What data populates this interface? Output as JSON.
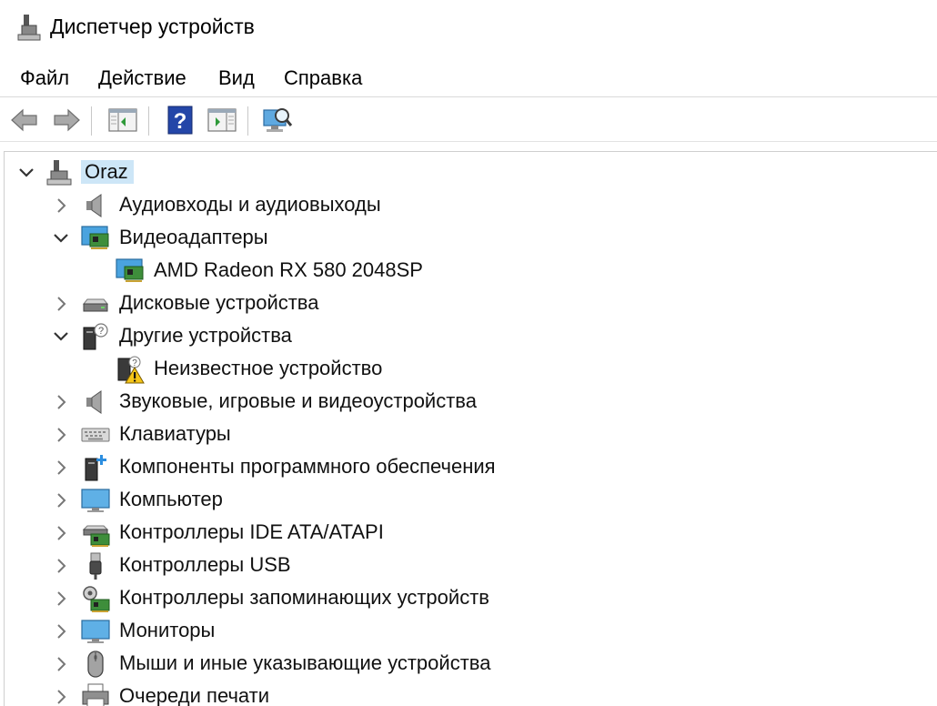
{
  "window": {
    "title": "Диспетчер устройств"
  },
  "menu": [
    "Файл",
    "Действие",
    "Вид",
    "Справка"
  ],
  "toolbar": {
    "buttons": [
      "back-arrow-icon",
      "forward-arrow-icon",
      "show-hide-console-tree-icon",
      "help-icon",
      "action-pane-icon",
      "scan-hardware-icon"
    ]
  },
  "tree": {
    "root": {
      "label": "Oraz",
      "expanded": true,
      "icon": "computer-root-icon"
    },
    "items": [
      {
        "label": "Аудиовходы и аудиовыходы",
        "expanded": false,
        "icon": "speaker-icon"
      },
      {
        "label": "Видеоадаптеры",
        "expanded": true,
        "icon": "display-adapter-icon",
        "children": [
          {
            "label": "AMD Radeon RX 580 2048SP",
            "icon": "display-adapter-icon"
          }
        ]
      },
      {
        "label": "Дисковые устройства",
        "expanded": false,
        "icon": "disk-drive-icon"
      },
      {
        "label": "Другие устройства",
        "expanded": true,
        "icon": "unknown-device-icon",
        "children": [
          {
            "label": "Неизвестное устройство",
            "icon": "warning-device-icon"
          }
        ]
      },
      {
        "label": "Звуковые, игровые и видеоустройства",
        "expanded": false,
        "icon": "speaker-icon"
      },
      {
        "label": "Клавиатуры",
        "expanded": false,
        "icon": "keyboard-icon"
      },
      {
        "label": "Компоненты программного обеспечения",
        "expanded": false,
        "icon": "software-component-icon"
      },
      {
        "label": "Компьютер",
        "expanded": false,
        "icon": "monitor-icon"
      },
      {
        "label": "Контроллеры IDE ATA/ATAPI",
        "expanded": false,
        "icon": "ide-controller-icon"
      },
      {
        "label": "Контроллеры USB",
        "expanded": false,
        "icon": "usb-icon"
      },
      {
        "label": "Контроллеры запоминающих устройств",
        "expanded": false,
        "icon": "storage-controller-icon"
      },
      {
        "label": "Мониторы",
        "expanded": false,
        "icon": "monitor-icon"
      },
      {
        "label": "Мыши и иные указывающие устройства",
        "expanded": false,
        "icon": "mouse-icon"
      },
      {
        "label": "Очереди печати",
        "expanded": false,
        "icon": "printer-icon"
      }
    ]
  }
}
